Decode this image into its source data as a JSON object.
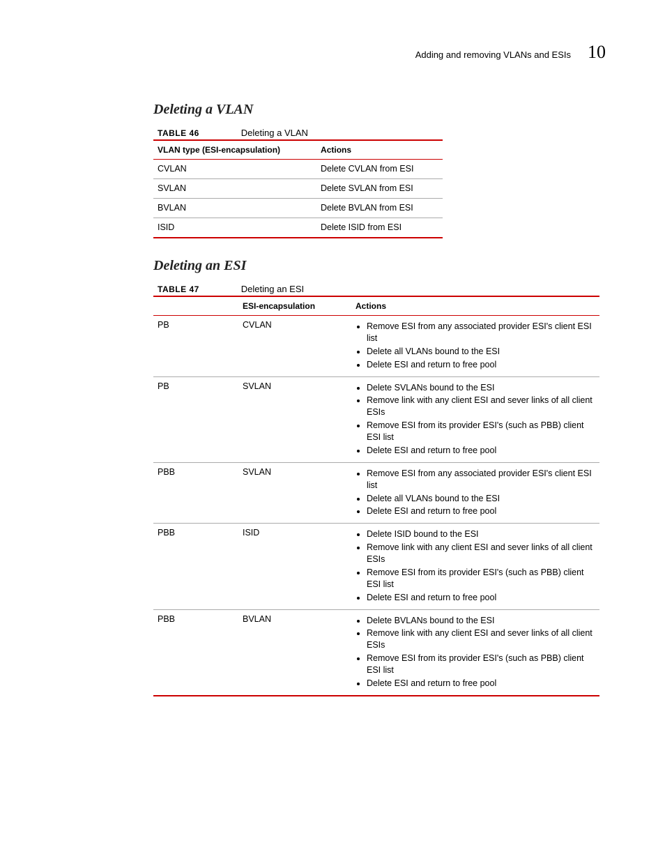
{
  "header": {
    "breadcrumb": "Adding and removing VLANs and ESIs",
    "chapter": "10"
  },
  "section1": {
    "title": "Deleting a VLAN"
  },
  "table46": {
    "label": "TABLE 46",
    "caption": "Deleting a VLAN",
    "headers": {
      "c1": "VLAN type (ESI-encapsulation)",
      "c2": "Actions"
    },
    "rows": [
      {
        "c1": "CVLAN",
        "c2": "Delete CVLAN from ESI"
      },
      {
        "c1": "SVLAN",
        "c2": "Delete SVLAN from ESI"
      },
      {
        "c1": "BVLAN",
        "c2": "Delete BVLAN from ESI"
      },
      {
        "c1": "ISID",
        "c2": "Delete ISID from ESI"
      }
    ]
  },
  "section2": {
    "title": "Deleting an ESI"
  },
  "table47": {
    "label": "TABLE 47",
    "caption": "Deleting an ESI",
    "headers": {
      "c1": "",
      "c2": "ESI-encapsulation",
      "c3": "Actions"
    },
    "rows": [
      {
        "c1": "PB",
        "c2": "CVLAN",
        "actions": [
          "Remove ESI from any associated provider ESI's client ESI list",
          "Delete all VLANs bound to the ESI",
          "Delete ESI and return to free pool"
        ]
      },
      {
        "c1": "PB",
        "c2": "SVLAN",
        "actions": [
          "Delete SVLANs bound to the ESI",
          "Remove link with any client ESI and sever links of all client ESIs",
          "Remove ESI from its provider ESI's (such as PBB) client ESI list",
          "Delete ESI and return to free pool"
        ]
      },
      {
        "c1": "PBB",
        "c2": "SVLAN",
        "actions": [
          "Remove ESI from any associated provider ESI's client ESI list",
          "Delete all VLANs bound to the ESI",
          "Delete ESI and return to free pool"
        ]
      },
      {
        "c1": "PBB",
        "c2": "ISID",
        "actions": [
          "Delete ISID bound to the ESI",
          "Remove link with any client ESI and sever links of all client ESIs",
          "Remove ESI from its provider ESI's (such as PBB) client ESI list",
          "Delete ESI and return to free pool"
        ]
      },
      {
        "c1": "PBB",
        "c2": "BVLAN",
        "actions": [
          "Delete BVLANs bound to the ESI",
          "Remove link with any client ESI and sever links of all client ESIs",
          "Remove ESI from its provider ESI's (such as PBB) client ESI list",
          "Delete ESI and return to free pool"
        ]
      }
    ]
  }
}
